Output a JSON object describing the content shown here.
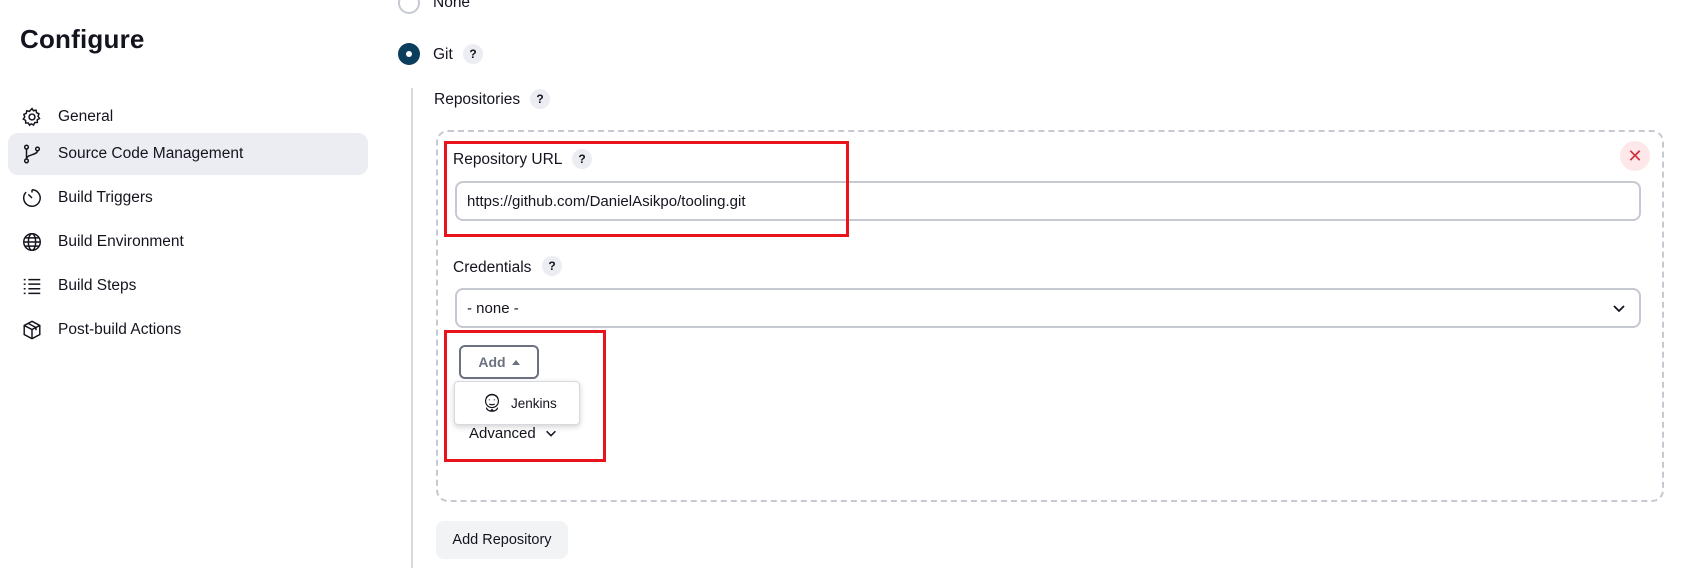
{
  "page": {
    "title": "Configure"
  },
  "sidebar": {
    "items": [
      {
        "label": "General",
        "icon": "gear-icon",
        "active": false
      },
      {
        "label": "Source Code Management",
        "icon": "git-branch-icon",
        "active": true
      },
      {
        "label": "Build Triggers",
        "icon": "timer-icon",
        "active": false
      },
      {
        "label": "Build Environment",
        "icon": "globe-icon",
        "active": false
      },
      {
        "label": "Build Steps",
        "icon": "list-icon",
        "active": false
      },
      {
        "label": "Post-build Actions",
        "icon": "package-icon",
        "active": false
      }
    ]
  },
  "scm": {
    "options": [
      {
        "label": "None",
        "selected": false
      },
      {
        "label": "Git",
        "selected": true
      }
    ],
    "help_label": "?",
    "repositories_label": "Repositories",
    "repository_url_label": "Repository URL",
    "repository_url_value": "https://github.com/DanielAsikpo/tooling.git",
    "credentials_label": "Credentials",
    "credentials_selected": "- none -",
    "add_button_label": "Add",
    "add_menu_items": [
      {
        "label": "Jenkins",
        "icon": "jenkins-icon"
      }
    ],
    "advanced_label": "Advanced",
    "add_repository_label": "Add Repository",
    "delete_icon": "close-icon"
  },
  "colors": {
    "accent": "#0b3d5c",
    "highlight": "#e8131c",
    "active_nav": "#ebedf2",
    "danger": "#d32f3f"
  }
}
